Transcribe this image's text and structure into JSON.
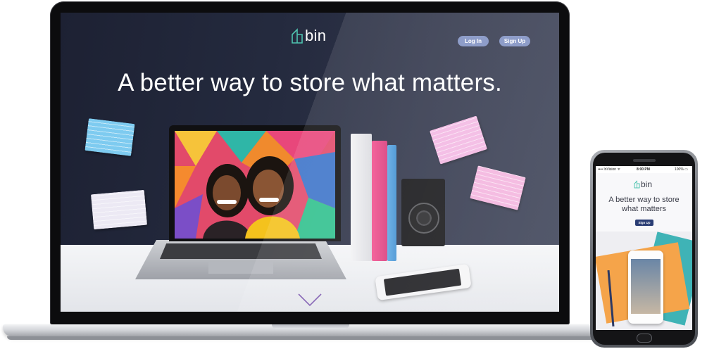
{
  "website": {
    "logo_text": "bin",
    "nav": {
      "login_label": "Log In",
      "signup_label": "Sign Up"
    },
    "hero_headline": "A better way to store what matters.",
    "scroll_icon": "chevron-down-icon",
    "colors": {
      "nav_button": "#8e9dc9",
      "hero_text": "#ffffff",
      "logo_accent": "#4fc4b0",
      "background": "#24273a"
    }
  },
  "mobile": {
    "status_bar": {
      "carrier": "•••• InVision ᯤ",
      "time": "8:00 PM",
      "battery": "100% ▭"
    },
    "logo_text": "bin",
    "headline": "A better way to store what matters",
    "signup_label": "Sign Up",
    "colors": {
      "signup_button": "#2a3d74",
      "headline_text": "#3a3c48"
    }
  }
}
